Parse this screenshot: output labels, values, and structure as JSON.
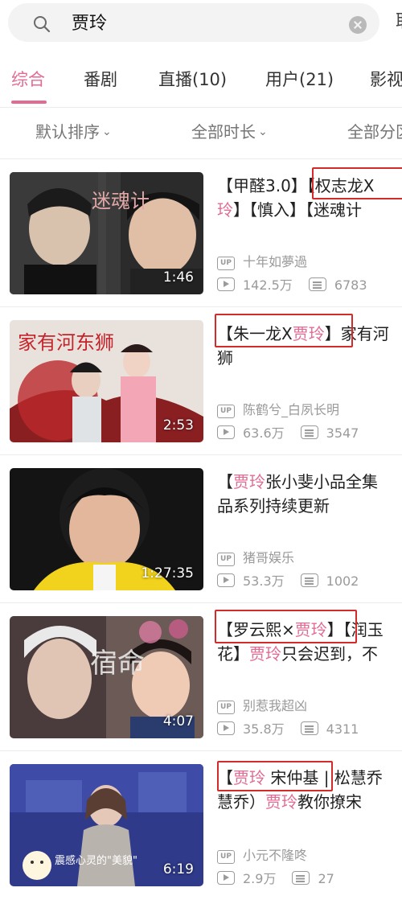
{
  "search": {
    "query": "贾玲",
    "cancel_label": "取"
  },
  "tabs": [
    {
      "label": "综合",
      "active": true
    },
    {
      "label": "番剧",
      "active": false
    },
    {
      "label": "直播(10)",
      "active": false
    },
    {
      "label": "用户(21)",
      "active": false
    },
    {
      "label": "影视",
      "active": false
    }
  ],
  "filters": [
    {
      "label": "默认排序"
    },
    {
      "label": "全部时长"
    },
    {
      "label": "全部分区"
    }
  ],
  "colors": {
    "accent": "#e26b93",
    "annotation_box": "#d32a2a",
    "meta_text": "#9a9a9a"
  },
  "videos": [
    {
      "title_parts": [
        {
          "text": "【甲醛3.0】【权志龙X",
          "hl": false
        },
        {
          "text": "贾",
          "hl": true
        },
        {
          "text": "玲",
          "hl": true
        },
        {
          "text": "】【慎入】【迷魂计",
          "hl": false
        }
      ],
      "title_line1": "【甲醛3.0】【权志龙X",
      "title_line2_hl": "玲",
      "title_line2_rest": "】【慎入】【迷魂计",
      "duration": "1:46",
      "thumb_caption": "迷魂计",
      "uploader": "十年如夢過",
      "views": "142.5万",
      "danmaku": "6783"
    },
    {
      "title_line1_pre": "【朱一龙X",
      "title_line1_hl": "贾玲",
      "title_line1_post": "】家有河",
      "title_line2": "狮",
      "duration": "2:53",
      "thumb_caption": "家有河东狮",
      "uploader": "陈鹤兮_白夙长明",
      "views": "63.6万",
      "danmaku": "3547"
    },
    {
      "title_line1_pre": "【",
      "title_line1_hl": "贾玲",
      "title_line1_post": "张小斐小品全集",
      "title_line2": "品系列持续更新",
      "duration": "1:27:35",
      "uploader": "猪哥娱乐",
      "views": "53.3万",
      "danmaku": "1002"
    },
    {
      "title_line1_pre": "【罗云熙×",
      "title_line1_hl": "贾玲",
      "title_line1_post": "】【润玉",
      "title_line2_pre": "花】",
      "title_line2_hl": "贾玲",
      "title_line2_post": "只会迟到，不",
      "duration": "4:07",
      "thumb_caption": "宿命",
      "uploader": "别惹我超凶",
      "views": "35.8万",
      "danmaku": "4311"
    },
    {
      "title_line1_pre": "【",
      "title_line1_hl": "贾玲",
      "title_line1_post": " 宋仲基 | 松慧乔",
      "title_line2_pre": "慧乔）",
      "title_line2_hl": "贾玲",
      "title_line2_post": "教你撩宋",
      "duration": "6:19",
      "thumb_caption": "震感心灵的\"美貌\"",
      "uploader": "小元不隆咚",
      "views": "2.9万",
      "danmaku": "27"
    }
  ]
}
